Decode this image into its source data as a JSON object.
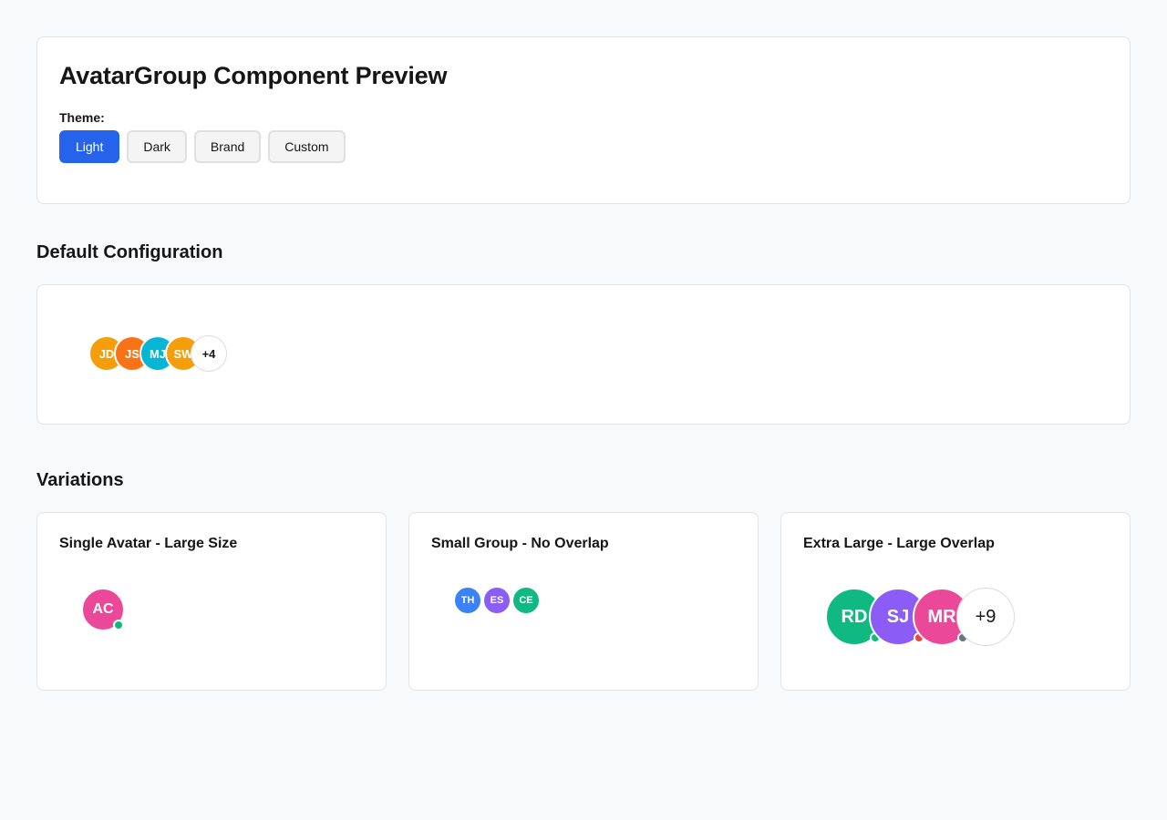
{
  "header": {
    "title": "AvatarGroup Component Preview",
    "theme_label": "Theme:",
    "themes": [
      {
        "label": "Light",
        "active": true
      },
      {
        "label": "Dark",
        "active": false
      },
      {
        "label": "Brand",
        "active": false
      },
      {
        "label": "Custom",
        "active": false
      }
    ]
  },
  "default_section": {
    "heading": "Default Configuration",
    "avatars": [
      {
        "initials": "JD",
        "color": "#f59e0b"
      },
      {
        "initials": "JS",
        "color": "#f97316"
      },
      {
        "initials": "MJ",
        "color": "#06b6d4"
      },
      {
        "initials": "SW",
        "color": "#f59e0b"
      }
    ],
    "overflow": "+4"
  },
  "variations_section": {
    "heading": "Variations",
    "cards": [
      {
        "title": "Single Avatar - Large Size",
        "avatars": [
          {
            "initials": "AC",
            "color": "#ec4899",
            "status_color": "#10b981"
          }
        ]
      },
      {
        "title": "Small Group - No Overlap",
        "avatars": [
          {
            "initials": "TH",
            "color": "#3b82f6"
          },
          {
            "initials": "ES",
            "color": "#8b5cf6"
          },
          {
            "initials": "CE",
            "color": "#10b981"
          }
        ]
      },
      {
        "title": "Extra Large - Large Overlap",
        "avatars": [
          {
            "initials": "RD",
            "color": "#10b981",
            "status_color": "#10b981"
          },
          {
            "initials": "SJ",
            "color": "#8b5cf6",
            "status_color": "#ef4444"
          },
          {
            "initials": "MR",
            "color": "#ec4899",
            "status_color": "#6b7280"
          }
        ],
        "overflow": "+9"
      }
    ]
  }
}
